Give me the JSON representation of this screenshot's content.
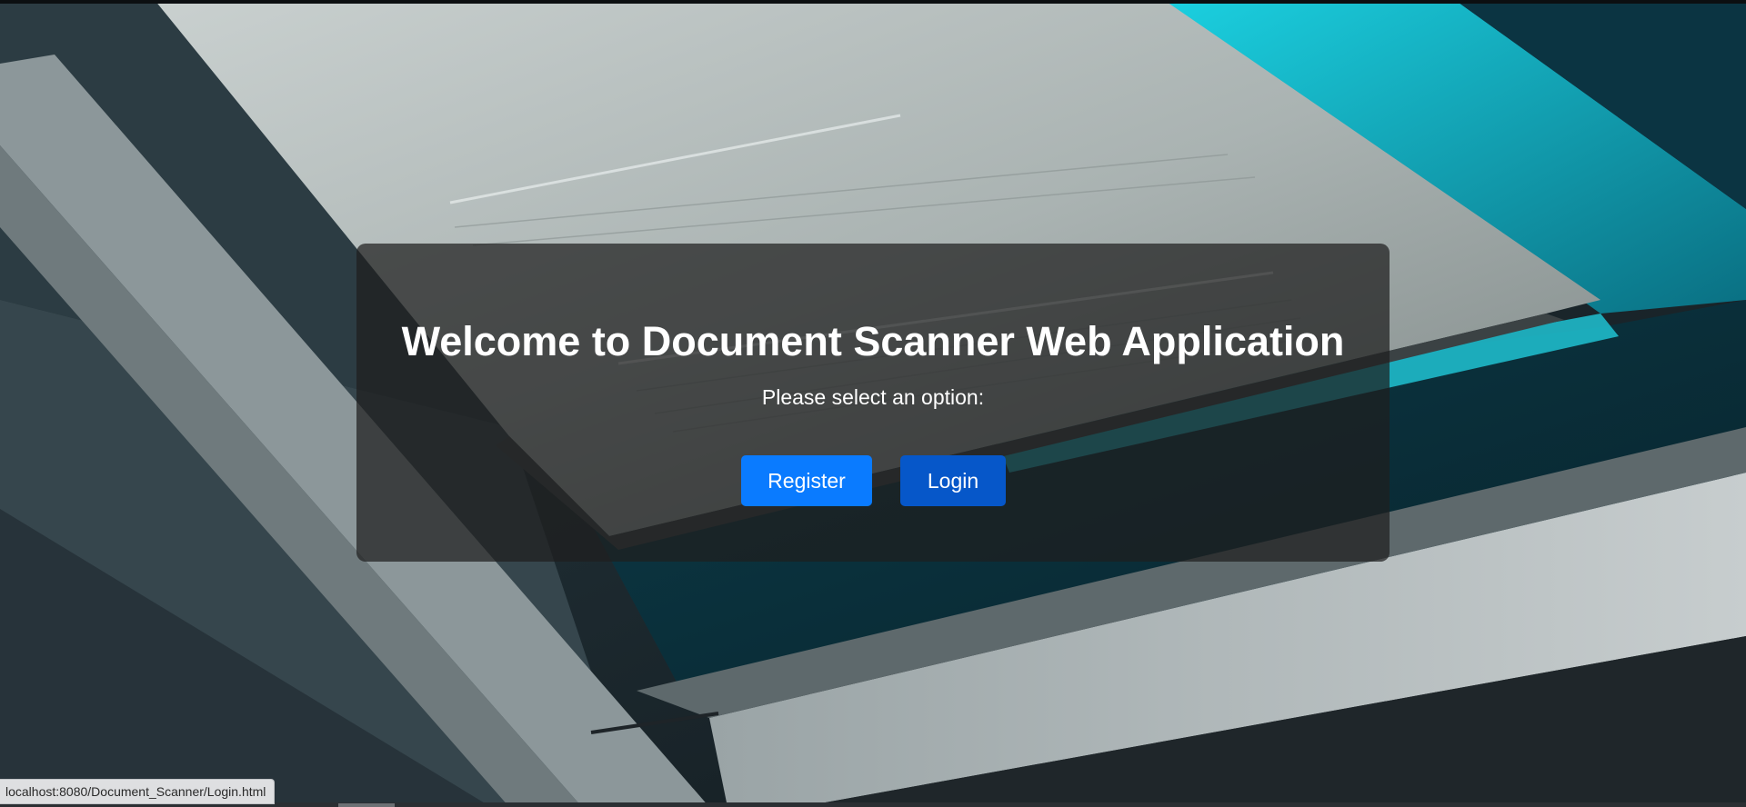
{
  "main": {
    "title": "Welcome to Document Scanner Web Application",
    "subtitle": "Please select an option:",
    "buttons": {
      "register_label": "Register",
      "login_label": "Login"
    }
  },
  "statusbar": {
    "url": "localhost:8080/Document_Scanner/Login.html"
  },
  "colors": {
    "register_button": "#0a7bff",
    "login_button": "#0657c9",
    "panel": "rgba(30,30,30,0.72)",
    "accent_teal": "#1fc6d6"
  }
}
